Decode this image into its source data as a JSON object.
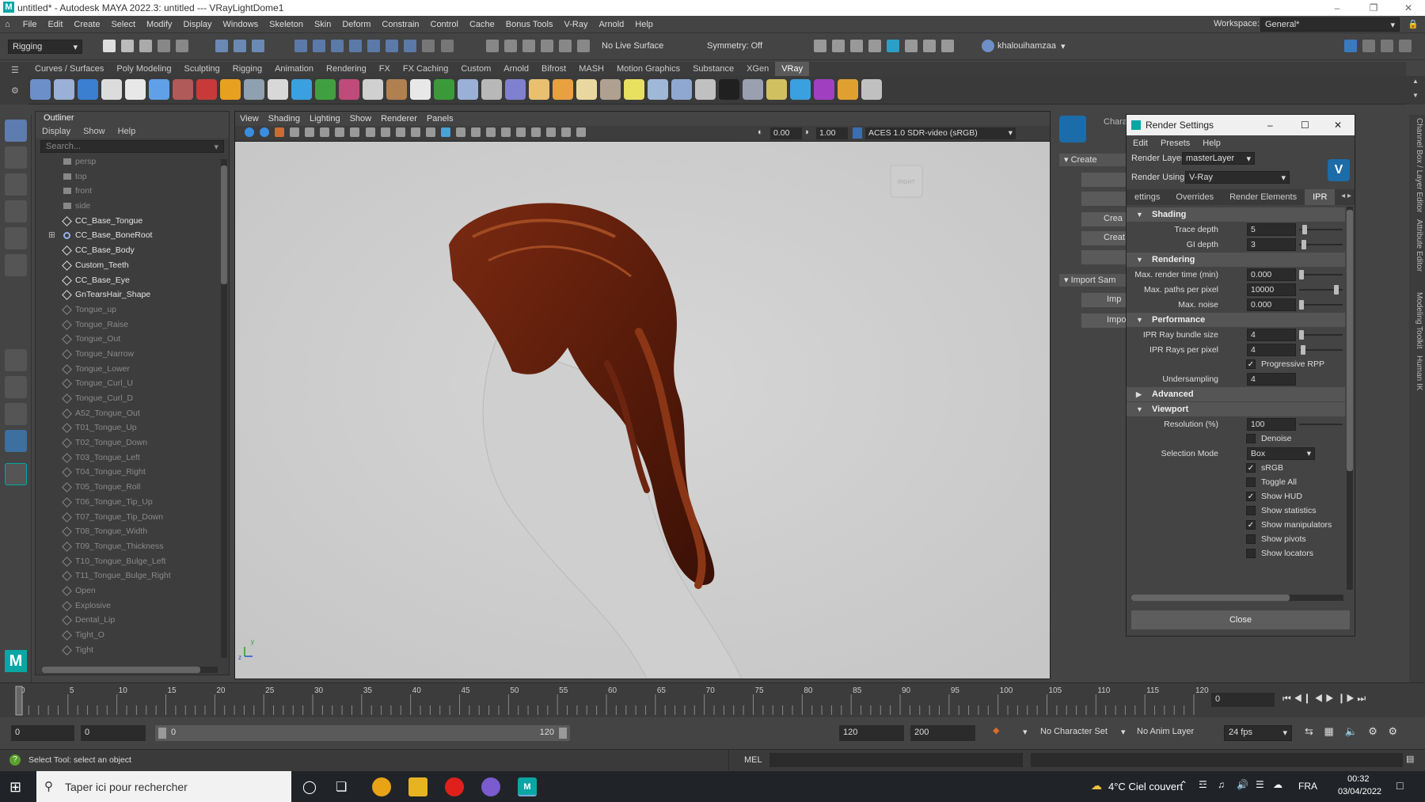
{
  "window": {
    "title": "untitled* - Autodesk MAYA 2022.3: untitled   ---   VRayLightDome1",
    "app_icon": "maya-m-icon",
    "controls": [
      "minimize-icon",
      "maximize-icon",
      "close-icon"
    ]
  },
  "menubar": {
    "items": [
      "File",
      "Edit",
      "Create",
      "Select",
      "Modify",
      "Display",
      "Windows",
      "Skeleton",
      "Skin",
      "Deform",
      "Constrain",
      "Control",
      "Cache",
      "Bonus Tools",
      "V-Ray",
      "Arnold",
      "Help"
    ],
    "workspace_label": "Workspace:",
    "workspace_value": "General*"
  },
  "statusline": {
    "menuset": "Rigging",
    "live_surface": "No Live Surface",
    "symmetry": "Symmetry: Off",
    "user": "khalouihamzaa"
  },
  "shelf": {
    "tabs": [
      "Curves / Surfaces",
      "Poly Modeling",
      "Sculpting",
      "Rigging",
      "Animation",
      "Rendering",
      "FX",
      "FX Caching",
      "Custom",
      "Arnold",
      "Bifrost",
      "MASH",
      "Motion Graphics",
      "Substance",
      "XGen",
      "VRay"
    ],
    "active_tab": "VRay"
  },
  "outliner": {
    "title": "Outliner",
    "menus": [
      "Display",
      "Show",
      "Help"
    ],
    "search_placeholder": "Search...",
    "items": [
      {
        "label": "persp",
        "dim": true,
        "icon": "camera-icon"
      },
      {
        "label": "top",
        "dim": true,
        "icon": "camera-icon"
      },
      {
        "label": "front",
        "dim": true,
        "icon": "camera-icon"
      },
      {
        "label": "side",
        "dim": true,
        "icon": "camera-icon"
      },
      {
        "label": "CC_Base_Tongue",
        "dim": false,
        "icon": "mesh-icon"
      },
      {
        "label": "CC_Base_BoneRoot",
        "dim": false,
        "icon": "joint-icon",
        "expand": true
      },
      {
        "label": "CC_Base_Body",
        "dim": false,
        "icon": "mesh-icon"
      },
      {
        "label": "Custom_Teeth",
        "dim": false,
        "icon": "mesh-icon"
      },
      {
        "label": "CC_Base_Eye",
        "dim": false,
        "icon": "mesh-icon"
      },
      {
        "label": "GnTearsHair_Shape",
        "dim": false,
        "icon": "mesh-icon"
      },
      {
        "label": "Tongue_up",
        "dim": true,
        "icon": "mesh-icon"
      },
      {
        "label": "Tongue_Raise",
        "dim": true,
        "icon": "mesh-icon"
      },
      {
        "label": "Tongue_Out",
        "dim": true,
        "icon": "mesh-icon"
      },
      {
        "label": "Tongue_Narrow",
        "dim": true,
        "icon": "mesh-icon"
      },
      {
        "label": "Tongue_Lower",
        "dim": true,
        "icon": "mesh-icon"
      },
      {
        "label": "Tongue_Curl_U",
        "dim": true,
        "icon": "mesh-icon"
      },
      {
        "label": "Tongue_Curl_D",
        "dim": true,
        "icon": "mesh-icon"
      },
      {
        "label": "A52_Tongue_Out",
        "dim": true,
        "icon": "mesh-icon"
      },
      {
        "label": "T01_Tongue_Up",
        "dim": true,
        "icon": "mesh-icon"
      },
      {
        "label": "T02_Tongue_Down",
        "dim": true,
        "icon": "mesh-icon"
      },
      {
        "label": "T03_Tongue_Left",
        "dim": true,
        "icon": "mesh-icon"
      },
      {
        "label": "T04_Tongue_Right",
        "dim": true,
        "icon": "mesh-icon"
      },
      {
        "label": "T05_Tongue_Roll",
        "dim": true,
        "icon": "mesh-icon"
      },
      {
        "label": "T06_Tongue_Tip_Up",
        "dim": true,
        "icon": "mesh-icon"
      },
      {
        "label": "T07_Tongue_Tip_Down",
        "dim": true,
        "icon": "mesh-icon"
      },
      {
        "label": "T08_Tongue_Width",
        "dim": true,
        "icon": "mesh-icon"
      },
      {
        "label": "T09_Tongue_Thickness",
        "dim": true,
        "icon": "mesh-icon"
      },
      {
        "label": "T10_Tongue_Bulge_Left",
        "dim": true,
        "icon": "mesh-icon"
      },
      {
        "label": "T11_Tongue_Bulge_Right",
        "dim": true,
        "icon": "mesh-icon"
      },
      {
        "label": "Open",
        "dim": true,
        "icon": "mesh-icon"
      },
      {
        "label": "Explosive",
        "dim": true,
        "icon": "mesh-icon"
      },
      {
        "label": "Dental_Lip",
        "dim": true,
        "icon": "mesh-icon"
      },
      {
        "label": "Tight_O",
        "dim": true,
        "icon": "mesh-icon"
      },
      {
        "label": "Tight",
        "dim": true,
        "icon": "mesh-icon"
      }
    ]
  },
  "viewport": {
    "menus": [
      "View",
      "Shading",
      "Lighting",
      "Show",
      "Renderer",
      "Panels"
    ],
    "exposure": "0.00",
    "gamma": "1.00",
    "color_space": "ACES 1.0 SDR-video (sRGB)",
    "view_cube": "RIGHT",
    "axis_labels": {
      "y": "y",
      "z": "z"
    }
  },
  "side_panel": {
    "chara": "Chara",
    "create": "Create",
    "crea1": "Crea",
    "creat": "Creat",
    "import_sam": "Import Sam",
    "imp1": "Imp",
    "imp2": "Impo"
  },
  "render_settings": {
    "title": "Render Settings",
    "menus": [
      "Edit",
      "Presets",
      "Help"
    ],
    "render_layer_label": "Render Layer",
    "render_layer": "masterLayer",
    "render_using_label": "Render Using",
    "render_using": "V-Ray",
    "tabs": [
      "ettings",
      "Overrides",
      "Render Elements",
      "IPR"
    ],
    "active_tab": "IPR",
    "sections": {
      "shading": "Shading",
      "rendering": "Rendering",
      "performance": "Performance",
      "advanced": "Advanced",
      "viewport": "Viewport"
    },
    "fields": {
      "trace_depth": {
        "label": "Trace depth",
        "value": "5"
      },
      "gi_depth": {
        "label": "GI depth",
        "value": "3"
      },
      "max_render_time": {
        "label": "Max. render time (min)",
        "value": "0.000"
      },
      "max_paths": {
        "label": "Max. paths per pixel",
        "value": "10000"
      },
      "max_noise": {
        "label": "Max. noise",
        "value": "0.000"
      },
      "ipr_bundle": {
        "label": "IPR Ray bundle size",
        "value": "4"
      },
      "ipr_rays": {
        "label": "IPR Rays per pixel",
        "value": "4"
      },
      "undersampling": {
        "label": "Undersampling",
        "value": "4"
      },
      "resolution": {
        "label": "Resolution (%)",
        "value": "100"
      },
      "selection_mode": {
        "label": "Selection Mode",
        "value": "Box"
      }
    },
    "checks": {
      "progressive_rpp": {
        "label": "Progressive RPP",
        "checked": true
      },
      "denoise": {
        "label": "Denoise",
        "checked": false
      },
      "srgb": {
        "label": "sRGB",
        "checked": true
      },
      "toggle_all": {
        "label": "Toggle All",
        "checked": false
      },
      "show_hud": {
        "label": "Show HUD",
        "checked": true
      },
      "show_statistics": {
        "label": "Show statistics",
        "checked": false
      },
      "show_manipulators": {
        "label": "Show manipulators",
        "checked": true
      },
      "show_pivots": {
        "label": "Show pivots",
        "checked": false
      },
      "show_locators": {
        "label": "Show locators",
        "checked": false
      }
    },
    "close": "Close"
  },
  "timeline": {
    "ticks": [
      "5",
      "10",
      "15",
      "20",
      "25",
      "30",
      "35",
      "40",
      "45",
      "50",
      "55",
      "60",
      "65",
      "70",
      "75",
      "80",
      "85",
      "90",
      "95",
      "100",
      "105",
      "110",
      "115",
      "120"
    ],
    "start_tick": "0",
    "current_frame": "0"
  },
  "range": {
    "start": "0",
    "playback_start": "0",
    "range_start_label": "0",
    "range_end_label": "120",
    "playback_end": "120",
    "end": "200",
    "character_set": "No Character Set",
    "anim_layer": "No Anim Layer",
    "fps": "24 fps"
  },
  "cmdline": {
    "help_text": "Select Tool: select an object",
    "lang": "MEL"
  },
  "right_tabs": [
    "Channel Box / Layer Editor",
    "Attribute Editor",
    "Modeling Toolkit",
    "Human IK"
  ],
  "taskbar": {
    "search_placeholder": "Taper ici pour rechercher",
    "weather": "4°C  Ciel couvert",
    "lang": "FRA",
    "time": "00:32",
    "date": "03/04/2022"
  }
}
